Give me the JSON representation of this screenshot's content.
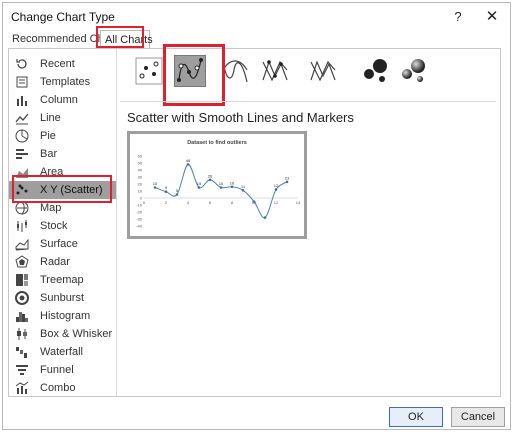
{
  "window": {
    "title": "Change Chart Type",
    "help": "?",
    "close": "✕"
  },
  "tabs": {
    "recommended": "Recommended Charts",
    "all": "All Charts"
  },
  "sidebar": {
    "items": [
      {
        "label": "Recent",
        "icon": "recent-icon"
      },
      {
        "label": "Templates",
        "icon": "templates-icon"
      },
      {
        "label": "Column",
        "icon": "column-chart-icon"
      },
      {
        "label": "Line",
        "icon": "line-chart-icon"
      },
      {
        "label": "Pie",
        "icon": "pie-chart-icon"
      },
      {
        "label": "Bar",
        "icon": "bar-chart-icon"
      },
      {
        "label": "Area",
        "icon": "area-chart-icon"
      },
      {
        "label": "X Y (Scatter)",
        "icon": "scatter-chart-icon"
      },
      {
        "label": "Map",
        "icon": "map-chart-icon"
      },
      {
        "label": "Stock",
        "icon": "stock-chart-icon"
      },
      {
        "label": "Surface",
        "icon": "surface-chart-icon"
      },
      {
        "label": "Radar",
        "icon": "radar-chart-icon"
      },
      {
        "label": "Treemap",
        "icon": "treemap-chart-icon"
      },
      {
        "label": "Sunburst",
        "icon": "sunburst-chart-icon"
      },
      {
        "label": "Histogram",
        "icon": "histogram-chart-icon"
      },
      {
        "label": "Box & Whisker",
        "icon": "box-whisker-chart-icon"
      },
      {
        "label": "Waterfall",
        "icon": "waterfall-chart-icon"
      },
      {
        "label": "Funnel",
        "icon": "funnel-chart-icon"
      },
      {
        "label": "Combo",
        "icon": "combo-chart-icon"
      }
    ],
    "selected": "X Y (Scatter)"
  },
  "subtypes": {
    "items": [
      {
        "icon": "scatter-markers-icon"
      },
      {
        "icon": "scatter-smooth-lines-markers-icon"
      },
      {
        "icon": "scatter-smooth-lines-icon"
      },
      {
        "icon": "scatter-straight-lines-markers-icon"
      },
      {
        "icon": "scatter-straight-lines-icon"
      },
      {
        "icon": "bubble-icon"
      },
      {
        "icon": "bubble-3d-icon"
      }
    ],
    "selected_title": "Scatter with Smooth Lines and Markers"
  },
  "preview": {
    "chart_data": {
      "type": "line",
      "title": "Dataset to find outliers",
      "x": [
        1,
        2,
        3,
        4,
        5,
        6,
        7,
        8,
        9,
        10,
        11,
        12,
        13
      ],
      "values": [
        15,
        9,
        5,
        48,
        15,
        26,
        15,
        16,
        11,
        -5,
        -28,
        12,
        23
      ],
      "xlim": [
        0,
        14
      ],
      "ylim": [
        -40,
        60
      ],
      "xticks": [
        0,
        2,
        4,
        6,
        8,
        10,
        12,
        14
      ],
      "yticks": [
        60,
        50,
        40,
        30,
        20,
        10,
        0,
        -10,
        -20,
        -30,
        -40
      ],
      "data_labels": [
        {
          "i": 0,
          "text": "15"
        },
        {
          "i": 1,
          "text": "9"
        },
        {
          "i": 2,
          "text": "5"
        },
        {
          "i": 3,
          "text": "48"
        },
        {
          "i": 4,
          "text": "15"
        },
        {
          "i": 5,
          "text": "26"
        },
        {
          "i": 6,
          "text": "15"
        },
        {
          "i": 7,
          "text": "16"
        },
        {
          "i": 8,
          "text": "11"
        },
        {
          "i": 11,
          "text": "12"
        },
        {
          "i": 12,
          "text": "23"
        }
      ],
      "line_color": "#4a7fc1",
      "marker_color": "#3b6fa8"
    }
  },
  "buttons": {
    "ok": "OK",
    "cancel": "Cancel"
  },
  "colors": {
    "highlight": "#e0202e",
    "selected_bg": "#9e9e9e"
  }
}
